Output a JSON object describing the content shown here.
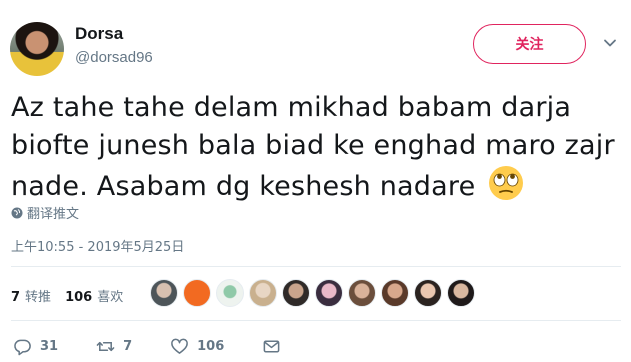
{
  "user": {
    "display_name": "Dorsa",
    "handle": "@dorsad96"
  },
  "follow_button": "关注",
  "tweet": {
    "text": "Az tahe tahe delam mikhad babam darja biofte junesh bala biad ke enghad maro zajr nade. Asabam dg keshesh nadare",
    "emoji": "face-with-rolling-eyes-icon",
    "translate_label": "翻译推文",
    "timestamp": "上午10:55 - 2019年5月25日"
  },
  "stats": {
    "retweets_count": "7",
    "retweets_label": "转推",
    "likes_count": "106",
    "likes_label": "喜欢"
  },
  "actions": {
    "reply_count": "31",
    "retweet_count": "7",
    "like_count": "106"
  },
  "colors": {
    "accent": "#e0245e",
    "secondary_text": "#657786",
    "divider": "#e6ecf0"
  }
}
